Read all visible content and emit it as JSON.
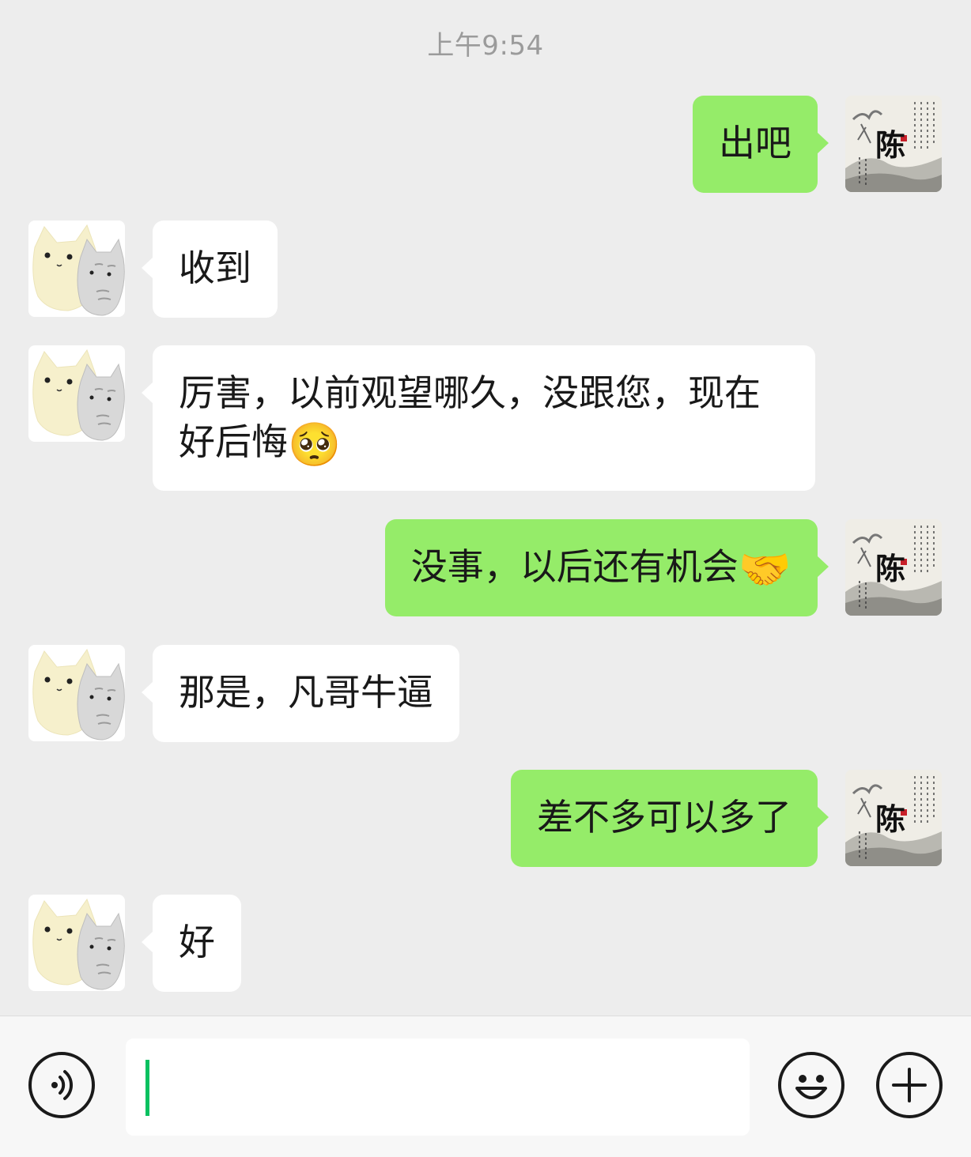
{
  "chat": {
    "timestamp": "上午9:54",
    "messages": [
      {
        "from": "me",
        "text": "出吧"
      },
      {
        "from": "other",
        "text": "收到"
      },
      {
        "from": "other",
        "text": "厉害，以前观望哪久，没跟您，现在好后悔",
        "emoji": "🥺"
      },
      {
        "from": "me",
        "text": "没事，以后还有机会",
        "emoji": "🤝"
      },
      {
        "from": "other",
        "text": "那是，凡哥牛逼"
      },
      {
        "from": "me",
        "text": "差不多可以多了"
      },
      {
        "from": "other",
        "text": "好"
      }
    ],
    "my_avatar_char": "陈"
  },
  "input_bar": {
    "voice_icon": "voice-icon",
    "emoji_icon": "emoji-icon",
    "more_icon": "plus-icon",
    "input_value": ""
  },
  "colors": {
    "background": "#ededed",
    "outgoing_bubble": "#95ec69",
    "incoming_bubble": "#ffffff",
    "caret": "#07c160"
  }
}
